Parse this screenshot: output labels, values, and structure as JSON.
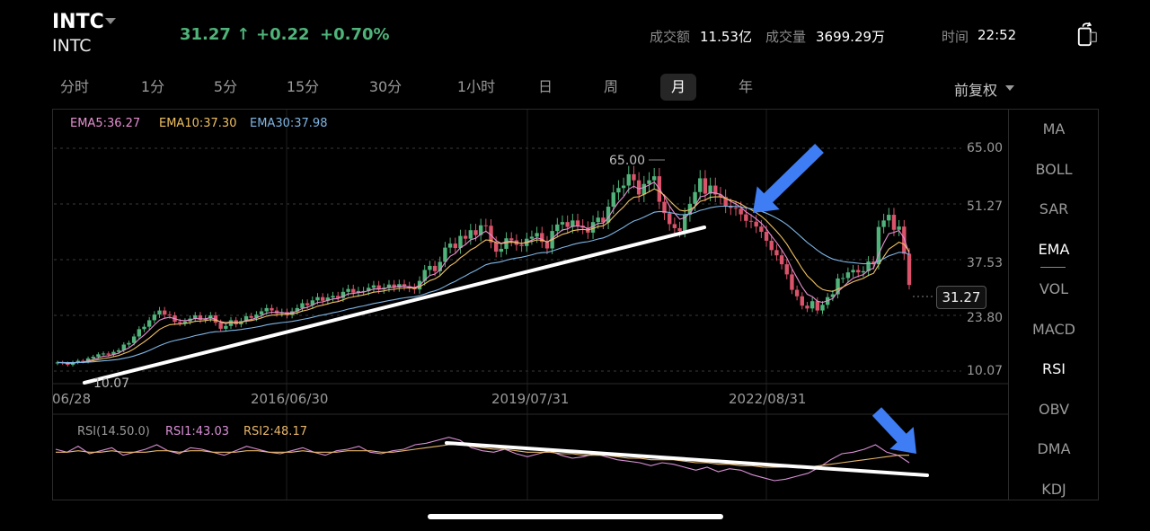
{
  "header": {
    "ticker": "INTC",
    "subticker": "INTC",
    "price": "31.27 ↑",
    "change": "+0.22",
    "change_pct": "+0.70%",
    "turnover_label": "成交额",
    "turnover_value": "11.53亿",
    "volume_label": "成交量",
    "volume_value": "3699.29万",
    "time_label": "时间",
    "time_value": "22:52"
  },
  "periods": [
    "分时",
    "1分",
    "5分",
    "15分",
    "30分",
    "1小时",
    "日",
    "周",
    "月",
    "年"
  ],
  "active_period": "月",
  "adjust_label": "前复权",
  "indicators": [
    "MA",
    "BOLL",
    "SAR",
    "EMA",
    "VOL",
    "MACD",
    "RSI",
    "OBV",
    "DMA",
    "KDJ"
  ],
  "active_indicator": "EMA",
  "colors": {
    "up": "#4fb37a",
    "down": "#d9536a",
    "ema5": "#e68fd0",
    "ema10": "#f0c060",
    "ema30": "#7fb6e6",
    "rsi1": "#d98fd6",
    "rsi2": "#e8b66a",
    "arrow": "#3f7df5"
  },
  "chart_data": [
    {
      "type": "candlestick",
      "legend": [
        {
          "name": "EMA5",
          "text": "EMA5:36.27"
        },
        {
          "name": "EMA10",
          "text": "EMA10:37.30"
        },
        {
          "name": "EMA30",
          "text": "EMA30:37.98"
        }
      ],
      "y_ticks": [
        "65.00",
        "51.27",
        "37.53",
        "23.80",
        "10.07"
      ],
      "y_tick_values": [
        65.0,
        51.27,
        37.53,
        23.8,
        10.07
      ],
      "x_ticks": [
        "06/28",
        "2016/06/30",
        "2019/07/31",
        "2022/08/31"
      ],
      "high_label": "65.00",
      "low_label": "10.07",
      "last_price": "31.27",
      "ylim": [
        10.07,
        65.0
      ],
      "close": [
        12.2,
        12.0,
        11.6,
        12.2,
        12.6,
        12.4,
        13.2,
        13.6,
        14.2,
        14.4,
        14.1,
        14.8,
        15.2,
        16.6,
        17.0,
        18.6,
        20.4,
        21.0,
        22.6,
        24.0,
        25.0,
        24.0,
        23.8,
        22.2,
        21.9,
        22.3,
        23.0,
        23.8,
        22.7,
        23.0,
        23.8,
        22.0,
        20.5,
        21.2,
        22.6,
        21.6,
        22.4,
        23.6,
        23.2,
        24.0,
        24.8,
        25.6,
        25.0,
        24.3,
        24.6,
        23.9,
        24.8,
        25.6,
        26.8,
        26.3,
        27.5,
        28.3,
        27.4,
        28.2,
        28.6,
        28.1,
        29.6,
        30.3,
        29.4,
        29.8,
        29.8,
        30.6,
        31.2,
        30.2,
        30.6,
        31.4,
        30.7,
        31.5,
        31.0,
        30.6,
        30.2,
        32.3,
        35.0,
        36.0,
        34.7,
        37.0,
        40.5,
        41.5,
        40.4,
        43.4,
        42.7,
        44.8,
        43.6,
        46.0,
        45.9,
        41.8,
        39.5,
        40.2,
        42.8,
        42.3,
        41.2,
        40.9,
        42.7,
        43.2,
        44.1,
        41.9,
        40.3,
        44.6,
        46.2,
        46.8,
        45.6,
        47.2,
        45.9,
        45.4,
        44.2,
        46.8,
        47.9,
        46.7,
        50.6,
        54.1,
        55.2,
        55.8,
        58.6,
        57.1,
        53.6,
        56.2,
        57.1,
        58.1,
        51.8,
        49.0,
        46.3,
        45.3,
        44.6,
        48.6,
        51.3,
        54.2,
        57.6,
        53.8,
        55.8,
        53.6,
        53.0,
        50.8,
        50.3,
        50.1,
        48.7,
        47.1,
        46.9,
        45.7,
        44.4,
        42.2,
        39.9,
        38.6,
        36.4,
        33.9,
        30.1,
        28.5,
        26.2,
        25.5,
        27.3,
        25.0,
        26.4,
        28.3,
        29.0,
        32.9,
        33.0,
        34.4,
        35.0,
        34.4,
        34.7,
        37.1,
        36.4,
        45.6,
        47.2,
        48.6,
        44.9,
        45.7,
        39.0,
        31.3
      ],
      "series": [
        {
          "name": "EMA5"
        },
        {
          "name": "EMA10"
        },
        {
          "name": "EMA30"
        }
      ],
      "trendline_up": [
        [
          "2014/06",
          "10.6"
        ],
        [
          "2021/02",
          "47.0"
        ]
      ]
    },
    {
      "type": "line",
      "legend": [
        {
          "name": "RSI(14.50.0)",
          "text": "RSI(14.50.0)"
        },
        {
          "name": "RSI1",
          "text": "RSI1:43.03"
        },
        {
          "name": "RSI2",
          "text": "RSI2:48.17"
        }
      ],
      "series": [
        {
          "name": "RSI1",
          "values": [
            52,
            50,
            54,
            49,
            51,
            53,
            48,
            50,
            52,
            55,
            51,
            49,
            53,
            52,
            50,
            48,
            51,
            54,
            52,
            50,
            49,
            51,
            53,
            50,
            48,
            51,
            52,
            54,
            50,
            49,
            51,
            52,
            55,
            56,
            58,
            60,
            58,
            53,
            51,
            50,
            52,
            49,
            47,
            49,
            51,
            48,
            46,
            47,
            49,
            47,
            45,
            44,
            43,
            41,
            43,
            42,
            40,
            38,
            40,
            37,
            39,
            38,
            35,
            33,
            31,
            32,
            34,
            36,
            40,
            45,
            49,
            50,
            52,
            55,
            50,
            48,
            43
          ]
        },
        {
          "name": "RSI2",
          "values": [
            50,
            50,
            51,
            50,
            50,
            51,
            50,
            50,
            50,
            51,
            51,
            50,
            51,
            51,
            50,
            50,
            50,
            51,
            51,
            50,
            50,
            50,
            51,
            50,
            50,
            50,
            51,
            51,
            51,
            50,
            50,
            51,
            52,
            53,
            54,
            55,
            55,
            54,
            53,
            52,
            52,
            51,
            50,
            50,
            50,
            49,
            49,
            48,
            48,
            48,
            47,
            46,
            46,
            45,
            45,
            45,
            44,
            43,
            43,
            42,
            42,
            41,
            41,
            40,
            40,
            40,
            40,
            40,
            41,
            42,
            43,
            44,
            45,
            46,
            47,
            48,
            48
          ]
        }
      ],
      "trendline_down": [
        [
          "2018",
          "high"
        ],
        [
          "2025",
          "low"
        ]
      ]
    }
  ]
}
